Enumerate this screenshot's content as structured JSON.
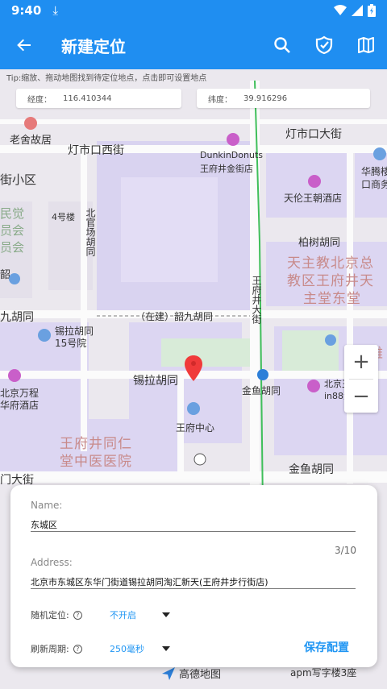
{
  "status_bar": {
    "time": "9:40"
  },
  "app_bar": {
    "title": "新建定位"
  },
  "map": {
    "tip": "Tip:缩放、拖动地图找到待定位地点，点击即可设置地点",
    "longitude_label": "经度：",
    "longitude": "116.410344",
    "latitude_label": "纬度：",
    "latitude": "39.916296",
    "labels": {
      "laoshe": "老舍故居",
      "dengshikou_west": "灯市口西街",
      "dengshikou_main": "灯市口大街",
      "dunkin": "DunkinDonuts",
      "dunkin_sub": "王府井金街店",
      "tianlun": "天伦王朝酒店",
      "huateng": "华腾楼",
      "huateng_sub": "口商务",
      "jiexiaoqu": "街小区",
      "minjue": "民觉",
      "yuanhui": "员会",
      "yuanhui2": "员会",
      "building4": "4号楼",
      "beiguan": "北官场胡同",
      "baishu": "柏树胡同",
      "church": "天主教北京总",
      "church2": "教区王府井天",
      "church3": "主堂东堂",
      "jiu": "九胡同",
      "shao": "韶",
      "wangfujing_st": "王府井大街",
      "zaijian": "（在建）韶九胡同",
      "xila_15": "锡拉胡同",
      "xila_15b": "15号院",
      "xila": "锡拉胡同",
      "jinyu": "金鱼胡同",
      "beijing_hotel": "北京万程",
      "beijing_hotel2": "华府酒店",
      "beijing_in88": "北京王府井银",
      "beijing_in88b": "in88酒店",
      "wfj_center": "王府中心",
      "tongren": "王府井同仁",
      "tongren2": "堂中医医院",
      "jinyu2": "金鱼胡同",
      "men": "门大街",
      "shenggong": "饰雅"
    },
    "brand": "高德地图",
    "brand_right": "apm写字楼3座"
  },
  "form": {
    "name_label": "Name:",
    "name_value": "东城区",
    "counter": "3/10",
    "address_label": "Address:",
    "address_value": "北京市东城区东华门街道锡拉胡同淘汇新天(王府井步行街店)",
    "random_label": "随机定位:",
    "random_value": "不开启",
    "refresh_label": "刷新周期:",
    "refresh_value": "250毫秒",
    "save": "保存配置"
  }
}
